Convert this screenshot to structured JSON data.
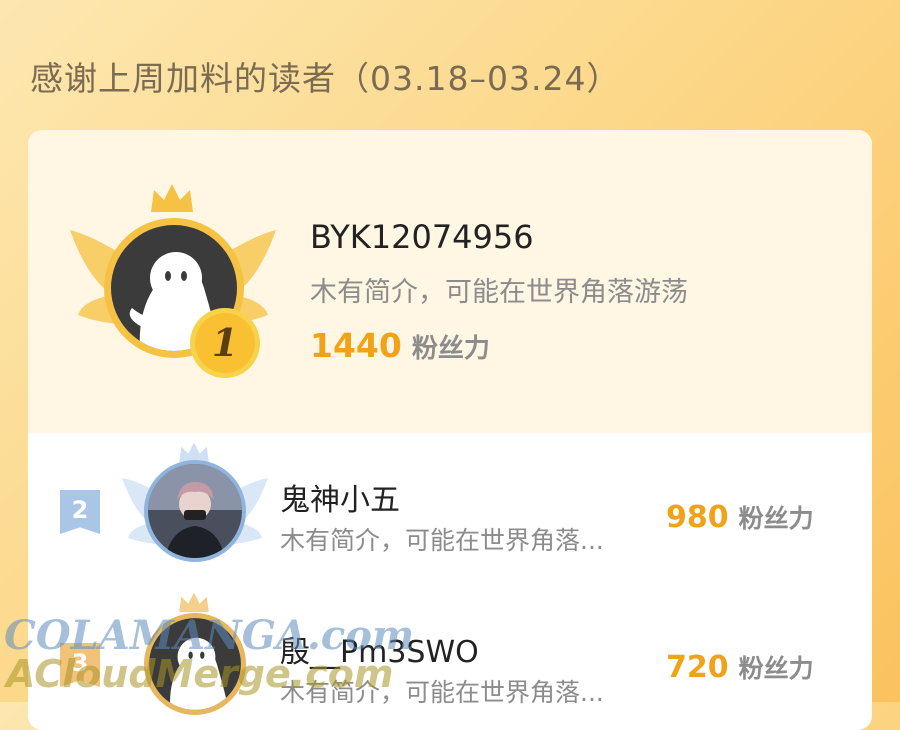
{
  "page_title": "感谢上周加料的读者（03.18–03.24）",
  "colors": {
    "accent": "#f0a318",
    "gold": "#f6c243",
    "silver": "#a9c6e6",
    "bronze": "#f1c27a"
  },
  "readers": [
    {
      "rank": "1",
      "name": "BYK12074956",
      "bio": "木有简介，可能在世界角落游荡",
      "score": "1440",
      "unit": "粉丝力",
      "avatar": "default-ghost-avatar"
    },
    {
      "rank": "2",
      "name": "鬼神小五",
      "bio": "木有简介，可能在世界角落...",
      "score": "980",
      "unit": "粉丝力",
      "avatar": "anime-character-avatar"
    },
    {
      "rank": "3",
      "name": "殷__Pm3SWO",
      "bio": "木有简介，可能在世界角落...",
      "score": "720",
      "unit": "粉丝力",
      "avatar": "default-ghost-avatar"
    }
  ],
  "watermark": {
    "line1": "COLAMANGA.com",
    "line2": "ACloudMerge.com"
  }
}
